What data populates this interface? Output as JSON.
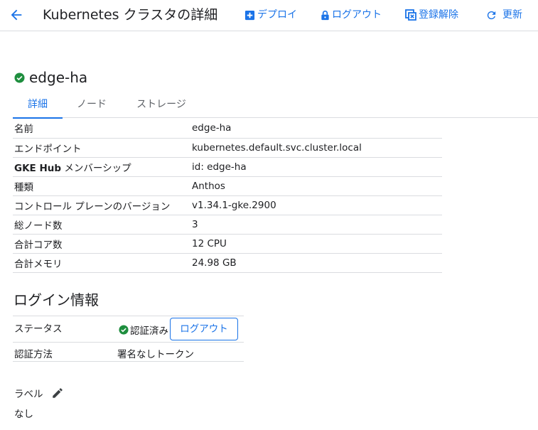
{
  "header": {
    "title": "Kubernetes クラスタの詳細",
    "actions": {
      "deploy": "デプロイ",
      "logout": "ログアウト",
      "unregister": "登録解除",
      "refresh": "更新"
    }
  },
  "cluster": {
    "name": "edge-ha",
    "status_color": "#1e8e3e"
  },
  "tabs": [
    {
      "label": "詳細",
      "active": true
    },
    {
      "label": "ノード",
      "active": false
    },
    {
      "label": "ストレージ",
      "active": false
    }
  ],
  "details": {
    "rows": [
      {
        "key": "名前",
        "value": "edge-ha"
      },
      {
        "key": "エンドポイント",
        "value": "kubernetes.default.svc.cluster.local"
      },
      {
        "key_bold": "GKE Hub",
        "key_rest": " メンバーシップ",
        "value": "id: edge-ha"
      },
      {
        "key": "種類",
        "value": "Anthos"
      },
      {
        "key": "コントロール プレーンのバージョン",
        "value": "v1.34.1-gke.2900"
      },
      {
        "key": "総ノード数",
        "value": "3"
      },
      {
        "key": "合計コア数",
        "value": "12 CPU"
      },
      {
        "key": "合計メモリ",
        "value": "24.98 GB"
      }
    ]
  },
  "login": {
    "title": "ログイン情報",
    "status_label": "ステータス",
    "status_value": "認証済み",
    "logout_button": "ログアウト",
    "auth_method_label": "認証方法",
    "auth_method_value": "署名なしトークン"
  },
  "labels": {
    "title": "ラベル",
    "value": "なし"
  },
  "colors": {
    "accent": "#1a73e8",
    "success": "#1e8e3e",
    "divider": "#dadce0",
    "text": "#202124"
  }
}
